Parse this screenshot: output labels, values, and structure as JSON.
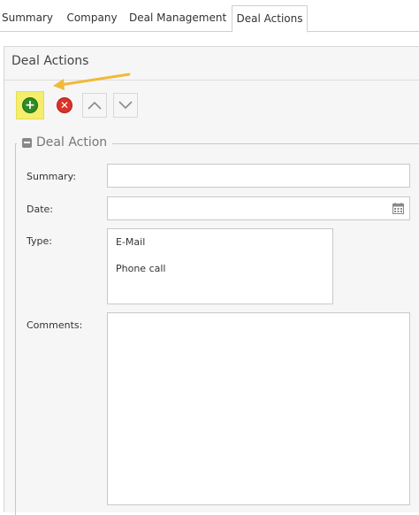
{
  "tabs": [
    {
      "label": "Summary",
      "active": false
    },
    {
      "label": "Company",
      "active": false
    },
    {
      "label": "Deal Management",
      "active": false
    },
    {
      "label": "Deal Actions",
      "active": true
    }
  ],
  "panel": {
    "title": "Deal Actions"
  },
  "toolbar": {
    "add_icon": "plus-circle-icon",
    "delete_icon": "x-circle-icon",
    "move_up_icon": "chevron-up-icon",
    "move_down_icon": "chevron-down-icon"
  },
  "fieldset": {
    "legend": "Deal Action"
  },
  "form": {
    "summary_label": "Summary:",
    "summary_value": "",
    "date_label": "Date:",
    "date_value": "",
    "type_label": "Type:",
    "type_options": [
      "E-Mail",
      "Phone call"
    ],
    "comments_label": "Comments:",
    "comments_value": ""
  },
  "colors": {
    "highlight": "#f4ee6c",
    "add_green": "#2f8b24",
    "delete_red": "#d9332a",
    "arrow_orange": "#f0b93a"
  }
}
